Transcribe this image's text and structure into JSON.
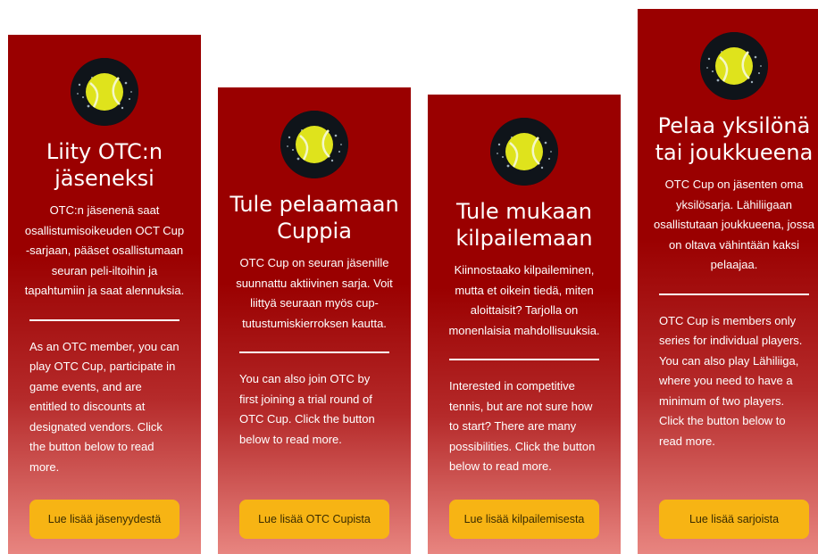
{
  "cards": [
    {
      "title": "Liity OTC:n jäseneksi",
      "description_fi": "OTC:n jäsenenä saat osallistumisoikeuden OCT Cup -sarjaan, pääset osallistumaan seuran peli-iltoihin ja tapahtumiin ja saat alennuksia.",
      "description_en": "As an OTC member, you can play OTC Cup, participate in game events, and are entitled to discounts at designated vendors. Click the button below to read more.",
      "button_label": "Lue lisää jäsenyydestä",
      "icon": "tennis-ball-icon"
    },
    {
      "title": "Tule pelaamaan Cuppia",
      "description_fi": "OTC Cup on seuran jäsenille suunnattu aktiivinen sarja. Voit liittyä seuraan myös cup-tutustumiskierroksen kautta.",
      "description_en": "You can also join OTC by first joining a trial round of OTC Cup. Click the button below to read more.",
      "button_label": "Lue lisää OTC Cupista",
      "icon": "tennis-ball-icon"
    },
    {
      "title": "Tule mukaan kilpailemaan",
      "description_fi": "Kiinnostaako kilpaileminen, mutta et oikein tiedä, miten aloittaisit? Tarjolla on monenlaisia mahdollisuuksia.",
      "description_en": "Interested in competitive tennis, but are not sure how to start? There are many possibilities. Click the button below to read more.",
      "button_label": "Lue lisää kilpailemisesta",
      "icon": "tennis-ball-icon"
    },
    {
      "title": "Pelaa yksilönä tai joukkueena",
      "description_fi": "OTC Cup on jäsenten oma yksilösarja. Lähiliigaan osallistutaan joukkueena, jossa on oltava vähintään kaksi pelaajaa.",
      "description_en": "OTC Cup is members only series for individual players. You can also play Lähiliiga, where you need to have a minimum of two players. Click the button below to read more.",
      "button_label": "Lue lisää sarjoista",
      "icon": "tennis-ball-icon"
    }
  ],
  "colors": {
    "card_red": "#9a0000",
    "card_pink": "#e88580",
    "button_yellow": "#f7b414",
    "ball_yellow": "#d9e021"
  }
}
